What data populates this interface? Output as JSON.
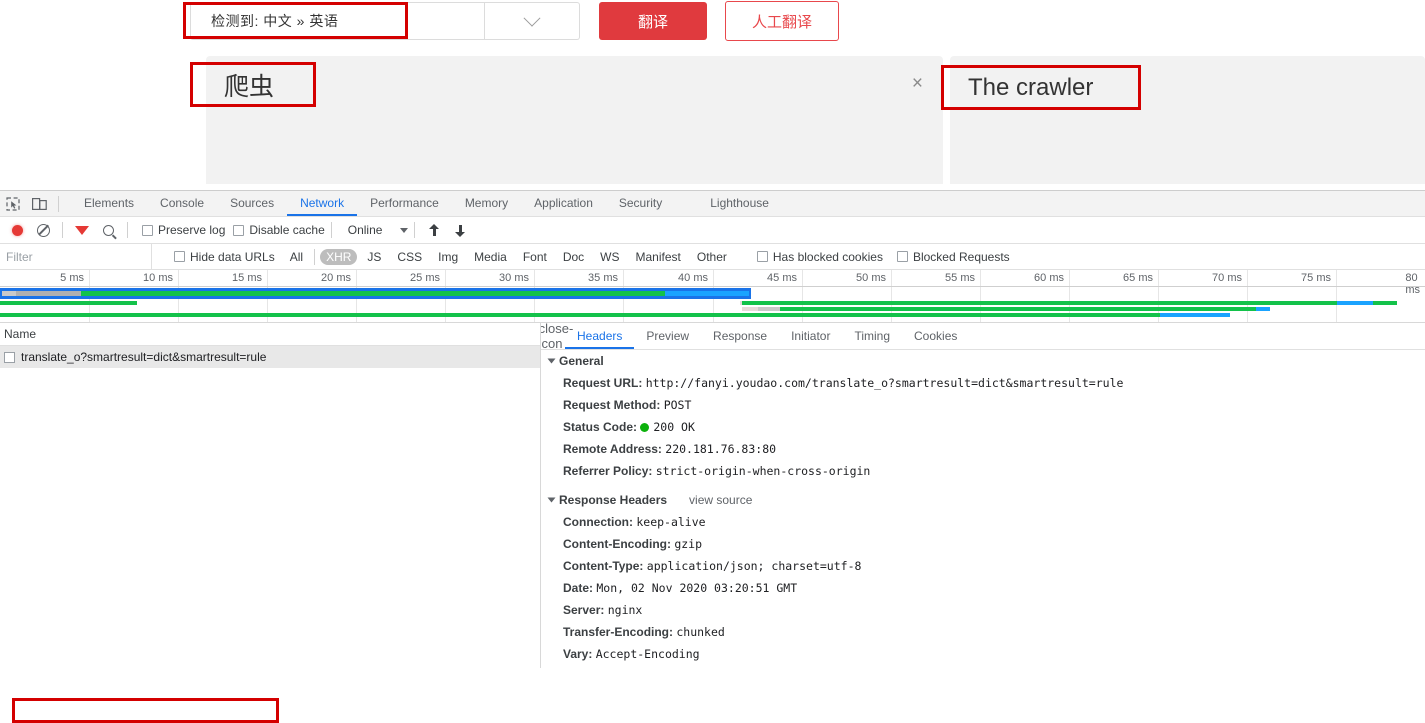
{
  "translate": {
    "lang_select": "检测到: 中文 » 英语",
    "caret_icon": "chevron-down-icon",
    "translate_button": "翻译",
    "human_translate_button": "人工翻译",
    "source_text": "爬虫",
    "clear_icon": "×",
    "target_text": "The crawler"
  },
  "devtools": {
    "tabs": [
      {
        "label": "Elements",
        "active": false
      },
      {
        "label": "Console",
        "active": false
      },
      {
        "label": "Sources",
        "active": false
      },
      {
        "label": "Network",
        "active": true
      },
      {
        "label": "Performance",
        "active": false
      },
      {
        "label": "Memory",
        "active": false
      },
      {
        "label": "Application",
        "active": false
      },
      {
        "label": "Security",
        "active": false
      },
      {
        "label": "Lighthouse",
        "active": false
      }
    ],
    "toolbar": {
      "record_icon": "record-icon",
      "clear_icon": "clear-icon",
      "filter_icon": "filter-funnel-icon",
      "search_icon": "search-icon",
      "preserve_log": "Preserve log",
      "disable_cache": "Disable cache",
      "throttling": "Online",
      "import_icon": "import-har-icon",
      "export_icon": "export-har-icon"
    },
    "filterbar": {
      "filter_placeholder": "Filter",
      "hide_data_urls": "Hide data URLs",
      "types": [
        "All",
        "XHR",
        "JS",
        "CSS",
        "Img",
        "Media",
        "Font",
        "Doc",
        "WS",
        "Manifest",
        "Other"
      ],
      "active_type": "XHR",
      "has_blocked_cookies": "Has blocked cookies",
      "blocked_requests": "Blocked Requests"
    },
    "timeline": {
      "ticks": [
        "5 ms",
        "10 ms",
        "15 ms",
        "20 ms",
        "25 ms",
        "30 ms",
        "35 ms",
        "40 ms",
        "45 ms",
        "50 ms",
        "55 ms",
        "60 ms",
        "65 ms",
        "70 ms",
        "75 ms",
        "80 ms"
      ],
      "unit": "ms",
      "max": 80,
      "colors": {
        "wait": "#c9c9c9",
        "stall": "#e8dada",
        "receive": "#13c24a",
        "frame": "#1a73e8",
        "download": "#1aa3ff"
      }
    },
    "request_list": {
      "column_name": "Name",
      "rows": [
        {
          "name": "translate_o?smartresult=dict&smartresult=rule",
          "selected": true
        }
      ]
    },
    "detail": {
      "close_icon": "close-icon",
      "tabs": [
        {
          "label": "Headers",
          "active": true
        },
        {
          "label": "Preview",
          "active": false
        },
        {
          "label": "Response",
          "active": false
        },
        {
          "label": "Initiator",
          "active": false
        },
        {
          "label": "Timing",
          "active": false
        },
        {
          "label": "Cookies",
          "active": false
        }
      ],
      "general": {
        "title": "General",
        "rows": [
          {
            "key": "Request URL:",
            "value": "http://fanyi.youdao.com/translate_o?smartresult=dict&smartresult=rule"
          },
          {
            "key": "Request Method:",
            "value": "POST"
          },
          {
            "key": "Status Code:",
            "value": "200 OK",
            "dot": "#0cb10c"
          },
          {
            "key": "Remote Address:",
            "value": "220.181.76.83:80"
          },
          {
            "key": "Referrer Policy:",
            "value": "strict-origin-when-cross-origin"
          }
        ]
      },
      "response_headers": {
        "title": "Response Headers",
        "view_source": "view source",
        "rows": [
          {
            "key": "Connection:",
            "value": "keep-alive"
          },
          {
            "key": "Content-Encoding:",
            "value": "gzip"
          },
          {
            "key": "Content-Type:",
            "value": "application/json; charset=utf-8"
          },
          {
            "key": "Date:",
            "value": "Mon, 02 Nov 2020 03:20:51 GMT"
          },
          {
            "key": "Server:",
            "value": "nginx"
          },
          {
            "key": "Transfer-Encoding:",
            "value": "chunked"
          },
          {
            "key": "Vary:",
            "value": "Accept-Encoding"
          }
        ]
      }
    }
  }
}
